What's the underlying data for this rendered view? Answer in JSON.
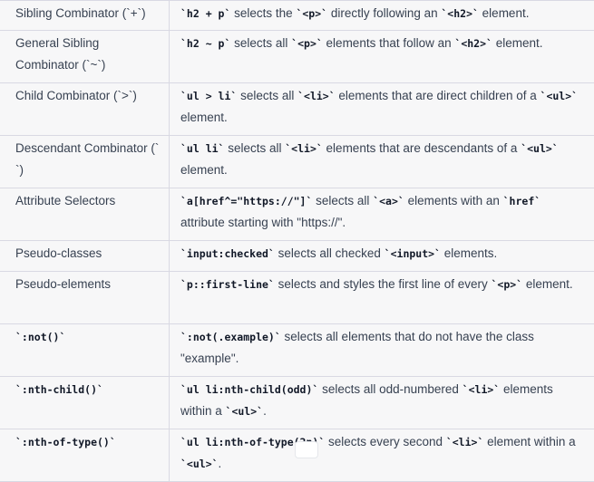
{
  "rows": [
    {
      "selector": [
        {
          "t": "Sibling Combinator (`+`)",
          "code": false
        }
      ],
      "description": [
        {
          "t": "`h2 + p`",
          "code": true
        },
        {
          "t": " selects the ",
          "code": false
        },
        {
          "t": "`<p>`",
          "code": true
        },
        {
          "t": " directly following an ",
          "code": false
        },
        {
          "t": "`<h2>`",
          "code": true
        },
        {
          "t": " element.",
          "code": false
        }
      ]
    },
    {
      "selector": [
        {
          "t": "General Sibling Combinator (`~`)",
          "code": false
        }
      ],
      "description": [
        {
          "t": "`h2 ~ p`",
          "code": true
        },
        {
          "t": " selects all ",
          "code": false
        },
        {
          "t": "`<p>`",
          "code": true
        },
        {
          "t": " elements that follow an ",
          "code": false
        },
        {
          "t": "`<h2>`",
          "code": true
        },
        {
          "t": " element.",
          "code": false
        }
      ]
    },
    {
      "selector": [
        {
          "t": "Child Combinator (`>`)",
          "code": false
        }
      ],
      "description": [
        {
          "t": "`ul > li`",
          "code": true
        },
        {
          "t": " selects all ",
          "code": false
        },
        {
          "t": "`<li>`",
          "code": true
        },
        {
          "t": " elements that are direct children of a ",
          "code": false
        },
        {
          "t": "`<ul>`",
          "code": true
        },
        {
          "t": " element.",
          "code": false
        }
      ]
    },
    {
      "selector": [
        {
          "t": "Descendant Combinator (` `)",
          "code": false
        }
      ],
      "description": [
        {
          "t": "`ul li`",
          "code": true
        },
        {
          "t": " selects all ",
          "code": false
        },
        {
          "t": "`<li>`",
          "code": true
        },
        {
          "t": " elements that are descendants of a ",
          "code": false
        },
        {
          "t": "`<ul>`",
          "code": true
        },
        {
          "t": " element.",
          "code": false
        }
      ]
    },
    {
      "selector": [
        {
          "t": "Attribute Selectors",
          "code": false
        }
      ],
      "description": [
        {
          "t": "`a[href^=\"https://\"]`",
          "code": true
        },
        {
          "t": " selects all ",
          "code": false
        },
        {
          "t": "`<a>`",
          "code": true
        },
        {
          "t": " elements with an ",
          "code": false
        },
        {
          "t": "`href`",
          "code": true
        },
        {
          "t": " attribute starting with \"https://\".",
          "code": false
        }
      ]
    },
    {
      "selector": [
        {
          "t": "Pseudo-classes",
          "code": false
        }
      ],
      "description": [
        {
          "t": "`input:checked`",
          "code": true
        },
        {
          "t": " selects all checked ",
          "code": false
        },
        {
          "t": "`<input>`",
          "code": true
        },
        {
          "t": " elements.",
          "code": false
        }
      ]
    },
    {
      "selector": [
        {
          "t": "Pseudo-elements",
          "code": false
        }
      ],
      "description": [
        {
          "t": "`p::first-line`",
          "code": true
        },
        {
          "t": " selects and styles the first line of every ",
          "code": false
        },
        {
          "t": "`<p>`",
          "code": true
        },
        {
          "t": " element.",
          "code": false
        }
      ]
    },
    {
      "selector": [
        {
          "t": "`:not()`",
          "code": true
        }
      ],
      "description": [
        {
          "t": "`:not(.example)`",
          "code": true
        },
        {
          "t": " selects all elements that do not have the class \"example\".",
          "code": false
        }
      ]
    },
    {
      "selector": [
        {
          "t": "`:nth-child()`",
          "code": true
        }
      ],
      "description": [
        {
          "t": "`ul li:nth-child(odd)`",
          "code": true
        },
        {
          "t": " selects all odd-numbered ",
          "code": false
        },
        {
          "t": "`<li>`",
          "code": true
        },
        {
          "t": " elements within a ",
          "code": false
        },
        {
          "t": "`<ul>`",
          "code": true
        },
        {
          "t": ".",
          "code": false
        }
      ]
    },
    {
      "selector": [
        {
          "t": "`:nth-of-type()`",
          "code": true
        }
      ],
      "description": [
        {
          "t": "`ul li:nth-of-type(2n)`",
          "code": true
        },
        {
          "t": " selects every second ",
          "code": false
        },
        {
          "t": "`<li>`",
          "code": true
        },
        {
          "t": " element within a ",
          "code": false
        },
        {
          "t": "`<ul>`",
          "code": true
        },
        {
          "t": ".",
          "code": false
        }
      ]
    }
  ]
}
